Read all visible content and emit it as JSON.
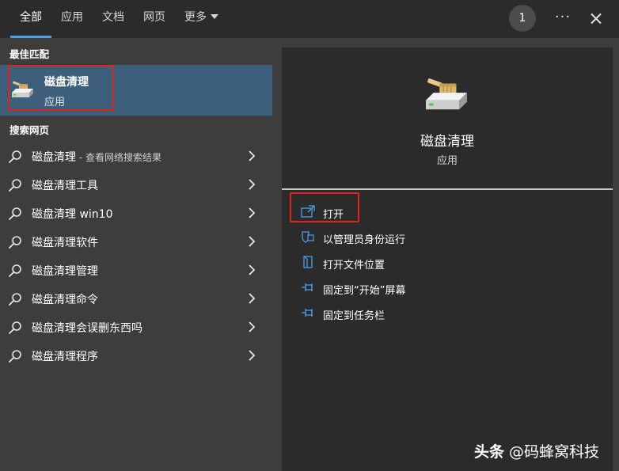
{
  "tabs": [
    {
      "label": "全部",
      "active": true
    },
    {
      "label": "应用",
      "active": false
    },
    {
      "label": "文档",
      "active": false
    },
    {
      "label": "网页",
      "active": false
    },
    {
      "label": "更多",
      "active": false
    }
  ],
  "topbar": {
    "badge": "1",
    "more_icon": "ellipsis-icon",
    "close_icon": "close-icon"
  },
  "left": {
    "best_match_title": "最佳匹配",
    "best_match": {
      "title": "磁盘清理",
      "subtitle": "应用",
      "icon": "disk-cleanup-icon"
    },
    "web_title": "搜索网页",
    "web_results": [
      {
        "label": "磁盘清理",
        "suffix": " - 查看网络搜索结果"
      },
      {
        "label": "磁盘清理工具",
        "suffix": ""
      },
      {
        "label": "磁盘清理 win10",
        "suffix": ""
      },
      {
        "label": "磁盘清理软件",
        "suffix": ""
      },
      {
        "label": "磁盘清理管理",
        "suffix": ""
      },
      {
        "label": "磁盘清理命令",
        "suffix": ""
      },
      {
        "label": "磁盘清理会误删东西吗",
        "suffix": ""
      },
      {
        "label": "磁盘清理程序",
        "suffix": ""
      }
    ]
  },
  "right": {
    "app_title": "磁盘清理",
    "app_subtitle": "应用",
    "actions": [
      {
        "label": "打开",
        "icon": "open-icon"
      },
      {
        "label": "以管理员身份运行",
        "icon": "shield-icon"
      },
      {
        "label": "打开文件位置",
        "icon": "file-location-icon"
      },
      {
        "label": "固定到“开始”屏幕",
        "icon": "pin-icon"
      },
      {
        "label": "固定到任务栏",
        "icon": "pin-icon"
      }
    ]
  },
  "watermark": {
    "brand": "头条",
    "handle": " @码蜂窝科技"
  },
  "colors": {
    "accent": "#4a9ee8",
    "selected_bg": "#3d5f7c",
    "highlight_box": "#e0241b",
    "panel_dark": "#2b2b2b",
    "panel_mid": "#3d3d3d"
  }
}
